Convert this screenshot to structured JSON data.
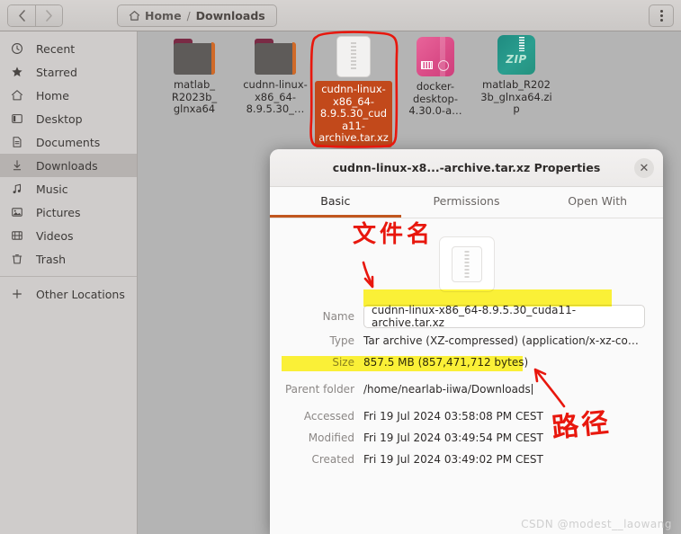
{
  "window": {
    "nav": {
      "back_label": "‹",
      "forward_label": "›"
    },
    "breadcrumb": {
      "home": "Home",
      "separator": "/",
      "current": "Downloads"
    },
    "menu_label": "⋮"
  },
  "sidebar": {
    "items": [
      {
        "label": "Recent",
        "icon": "clock-icon",
        "active": false
      },
      {
        "label": "Starred",
        "icon": "star-icon",
        "active": false
      },
      {
        "label": "Home",
        "icon": "home-icon",
        "active": false
      },
      {
        "label": "Desktop",
        "icon": "desktop-icon",
        "active": false
      },
      {
        "label": "Documents",
        "icon": "document-icon",
        "active": false
      },
      {
        "label": "Downloads",
        "icon": "download-icon",
        "active": true
      },
      {
        "label": "Music",
        "icon": "music-note-icon",
        "active": false
      },
      {
        "label": "Pictures",
        "icon": "image-icon",
        "active": false
      },
      {
        "label": "Videos",
        "icon": "film-icon",
        "active": false
      },
      {
        "label": "Trash",
        "icon": "trash-icon",
        "active": false
      }
    ],
    "other_locations": {
      "label": "Other Locations",
      "icon": "plus-icon"
    }
  },
  "files": [
    {
      "name": "matlab_\nR2023b_\nglnxa64",
      "label": "matlab_ R2023b_ glnxa64",
      "kind": "folder",
      "selected": false
    },
    {
      "name": "cudnn-linux-x86_64-8.9.5.30_…",
      "label": "cudnn-linux-x86_64-8.9.5.30_…",
      "kind": "folder",
      "selected": false
    },
    {
      "name": "cudnn-linux-x86_64-8.9.5.30_cuda11-archive.tar.xz",
      "label": "cudnn-linux-x86_64-8.9.5.30_cuda11-archive.tar.xz",
      "kind": "archive",
      "selected": true
    },
    {
      "name": "docker-desktop-4.30.0-a…",
      "label": "docker-desktop-4.30.0-a…",
      "kind": "deb",
      "selected": false
    },
    {
      "name": "matlab_R2023b_glnxa64.zip",
      "label": "matlab_R2023b_glnxa64.zip",
      "kind": "zip",
      "selected": false
    }
  ],
  "dialog": {
    "title": "cudnn-linux-x8...-archive.tar.xz Properties",
    "close_label": "✕",
    "tabs": [
      {
        "label": "Basic",
        "active": true
      },
      {
        "label": "Permissions",
        "active": false
      },
      {
        "label": "Open With",
        "active": false
      }
    ],
    "fields": {
      "name_label": "Name",
      "name_value": "cudnn-linux-x86_64-8.9.5.30_cuda11-archive.tar.xz",
      "type_label": "Type",
      "type_value": "Tar archive (XZ-compressed) (application/x-xz-compress…",
      "size_label": "Size",
      "size_value": "857.5 MB (857,471,712 bytes)",
      "parent_label": "Parent folder",
      "parent_value": "/home/nearlab-iiwa/Downloads",
      "accessed_label": "Accessed",
      "accessed_value": "Fri 19 Jul 2024 03:58:08 PM CEST",
      "modified_label": "Modified",
      "modified_value": "Fri 19 Jul 2024 03:49:54 PM CEST",
      "created_label": "Created",
      "created_value": "Fri 19 Jul 2024 03:49:02 PM CEST"
    }
  },
  "annotations": {
    "filename_note": "文件名",
    "path_note": "路径",
    "accent_red": "#e8170d",
    "highlight_yellow": "#fff200",
    "selection_orange": "#c2491b"
  },
  "watermark": {
    "text": "CSDN @modest__laowang"
  }
}
